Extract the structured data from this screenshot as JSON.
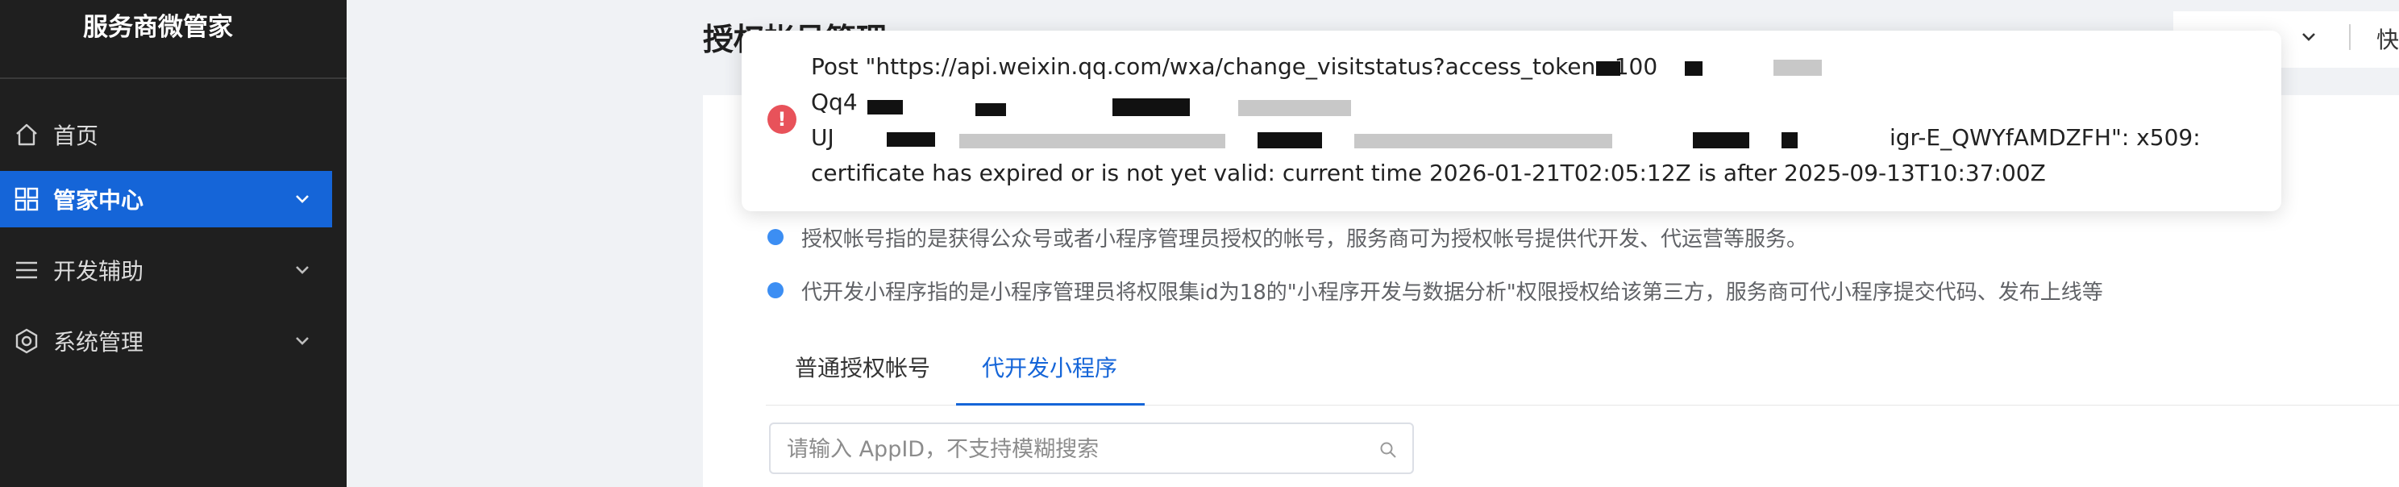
{
  "sidebar": {
    "brand": "服务商微管家",
    "items": [
      {
        "label": "首页",
        "icon": "home-icon",
        "active": false
      },
      {
        "label": "管家中心",
        "icon": "grid-icon",
        "active": true
      },
      {
        "label": "开发辅助",
        "icon": "menu-icon",
        "active": false
      },
      {
        "label": "系统管理",
        "icon": "settings-icon",
        "active": false
      }
    ]
  },
  "header": {
    "page_title": "授权帐号管理",
    "right_text": "快"
  },
  "toast": {
    "type": "error",
    "icon": "error-icon",
    "line1": "Post \"https://api.weixin.qq.com/wxa/change_visitstatus?access_token=100",
    "line2": "Qq4",
    "line3_prefix": "UJ",
    "line3_suffix": "igr-E_QWYfAMDZFH\": x509:",
    "line4": "certificate has expired or is not yet valid: current time 2026-01-21T02:05:12Z is after 2025-09-13T10:37:00Z"
  },
  "info": [
    "授权帐号指的是获得公众号或者小程序管理员授权的帐号，服务商可为授权帐号提供代开发、代运营等服务。",
    "代开发小程序指的是小程序管理员将权限集id为18的\"小程序开发与数据分析\"权限授权给该第三方，服务商可代小程序提交代码、发布上线等"
  ],
  "tabs": [
    {
      "label": "普通授权帐号",
      "active": false
    },
    {
      "label": "代开发小程序",
      "active": true
    }
  ],
  "search": {
    "placeholder": "请输入 AppID，不支持模糊搜索",
    "value": ""
  },
  "colors": {
    "sidebar_bg": "#1f1f1f",
    "accent": "#1565d8",
    "error": "#e8525a"
  }
}
